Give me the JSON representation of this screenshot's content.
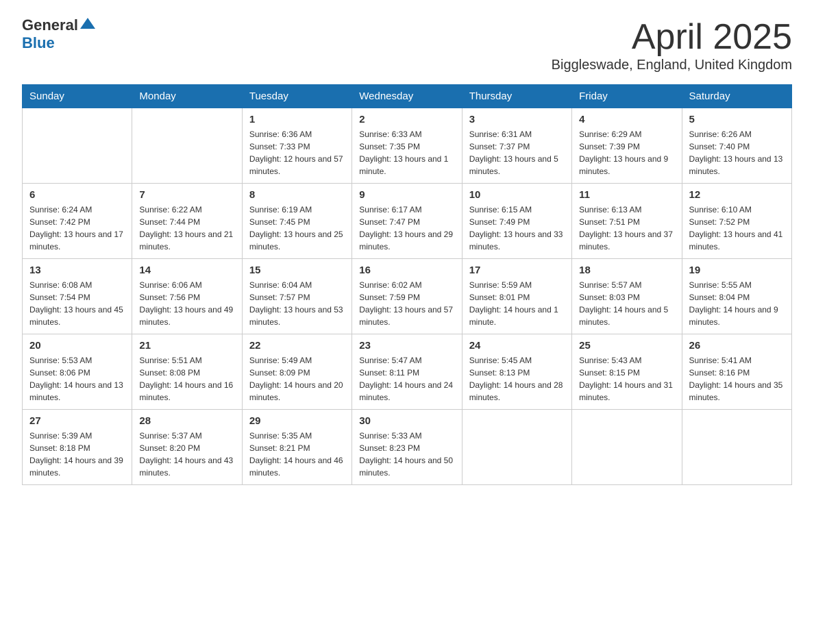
{
  "header": {
    "title": "April 2025",
    "location": "Biggleswade, England, United Kingdom",
    "logo_general": "General",
    "logo_blue": "Blue"
  },
  "days_of_week": [
    "Sunday",
    "Monday",
    "Tuesday",
    "Wednesday",
    "Thursday",
    "Friday",
    "Saturday"
  ],
  "weeks": [
    [
      {
        "day": "",
        "sunrise": "",
        "sunset": "",
        "daylight": ""
      },
      {
        "day": "",
        "sunrise": "",
        "sunset": "",
        "daylight": ""
      },
      {
        "day": "1",
        "sunrise": "Sunrise: 6:36 AM",
        "sunset": "Sunset: 7:33 PM",
        "daylight": "Daylight: 12 hours and 57 minutes."
      },
      {
        "day": "2",
        "sunrise": "Sunrise: 6:33 AM",
        "sunset": "Sunset: 7:35 PM",
        "daylight": "Daylight: 13 hours and 1 minute."
      },
      {
        "day": "3",
        "sunrise": "Sunrise: 6:31 AM",
        "sunset": "Sunset: 7:37 PM",
        "daylight": "Daylight: 13 hours and 5 minutes."
      },
      {
        "day": "4",
        "sunrise": "Sunrise: 6:29 AM",
        "sunset": "Sunset: 7:39 PM",
        "daylight": "Daylight: 13 hours and 9 minutes."
      },
      {
        "day": "5",
        "sunrise": "Sunrise: 6:26 AM",
        "sunset": "Sunset: 7:40 PM",
        "daylight": "Daylight: 13 hours and 13 minutes."
      }
    ],
    [
      {
        "day": "6",
        "sunrise": "Sunrise: 6:24 AM",
        "sunset": "Sunset: 7:42 PM",
        "daylight": "Daylight: 13 hours and 17 minutes."
      },
      {
        "day": "7",
        "sunrise": "Sunrise: 6:22 AM",
        "sunset": "Sunset: 7:44 PM",
        "daylight": "Daylight: 13 hours and 21 minutes."
      },
      {
        "day": "8",
        "sunrise": "Sunrise: 6:19 AM",
        "sunset": "Sunset: 7:45 PM",
        "daylight": "Daylight: 13 hours and 25 minutes."
      },
      {
        "day": "9",
        "sunrise": "Sunrise: 6:17 AM",
        "sunset": "Sunset: 7:47 PM",
        "daylight": "Daylight: 13 hours and 29 minutes."
      },
      {
        "day": "10",
        "sunrise": "Sunrise: 6:15 AM",
        "sunset": "Sunset: 7:49 PM",
        "daylight": "Daylight: 13 hours and 33 minutes."
      },
      {
        "day": "11",
        "sunrise": "Sunrise: 6:13 AM",
        "sunset": "Sunset: 7:51 PM",
        "daylight": "Daylight: 13 hours and 37 minutes."
      },
      {
        "day": "12",
        "sunrise": "Sunrise: 6:10 AM",
        "sunset": "Sunset: 7:52 PM",
        "daylight": "Daylight: 13 hours and 41 minutes."
      }
    ],
    [
      {
        "day": "13",
        "sunrise": "Sunrise: 6:08 AM",
        "sunset": "Sunset: 7:54 PM",
        "daylight": "Daylight: 13 hours and 45 minutes."
      },
      {
        "day": "14",
        "sunrise": "Sunrise: 6:06 AM",
        "sunset": "Sunset: 7:56 PM",
        "daylight": "Daylight: 13 hours and 49 minutes."
      },
      {
        "day": "15",
        "sunrise": "Sunrise: 6:04 AM",
        "sunset": "Sunset: 7:57 PM",
        "daylight": "Daylight: 13 hours and 53 minutes."
      },
      {
        "day": "16",
        "sunrise": "Sunrise: 6:02 AM",
        "sunset": "Sunset: 7:59 PM",
        "daylight": "Daylight: 13 hours and 57 minutes."
      },
      {
        "day": "17",
        "sunrise": "Sunrise: 5:59 AM",
        "sunset": "Sunset: 8:01 PM",
        "daylight": "Daylight: 14 hours and 1 minute."
      },
      {
        "day": "18",
        "sunrise": "Sunrise: 5:57 AM",
        "sunset": "Sunset: 8:03 PM",
        "daylight": "Daylight: 14 hours and 5 minutes."
      },
      {
        "day": "19",
        "sunrise": "Sunrise: 5:55 AM",
        "sunset": "Sunset: 8:04 PM",
        "daylight": "Daylight: 14 hours and 9 minutes."
      }
    ],
    [
      {
        "day": "20",
        "sunrise": "Sunrise: 5:53 AM",
        "sunset": "Sunset: 8:06 PM",
        "daylight": "Daylight: 14 hours and 13 minutes."
      },
      {
        "day": "21",
        "sunrise": "Sunrise: 5:51 AM",
        "sunset": "Sunset: 8:08 PM",
        "daylight": "Daylight: 14 hours and 16 minutes."
      },
      {
        "day": "22",
        "sunrise": "Sunrise: 5:49 AM",
        "sunset": "Sunset: 8:09 PM",
        "daylight": "Daylight: 14 hours and 20 minutes."
      },
      {
        "day": "23",
        "sunrise": "Sunrise: 5:47 AM",
        "sunset": "Sunset: 8:11 PM",
        "daylight": "Daylight: 14 hours and 24 minutes."
      },
      {
        "day": "24",
        "sunrise": "Sunrise: 5:45 AM",
        "sunset": "Sunset: 8:13 PM",
        "daylight": "Daylight: 14 hours and 28 minutes."
      },
      {
        "day": "25",
        "sunrise": "Sunrise: 5:43 AM",
        "sunset": "Sunset: 8:15 PM",
        "daylight": "Daylight: 14 hours and 31 minutes."
      },
      {
        "day": "26",
        "sunrise": "Sunrise: 5:41 AM",
        "sunset": "Sunset: 8:16 PM",
        "daylight": "Daylight: 14 hours and 35 minutes."
      }
    ],
    [
      {
        "day": "27",
        "sunrise": "Sunrise: 5:39 AM",
        "sunset": "Sunset: 8:18 PM",
        "daylight": "Daylight: 14 hours and 39 minutes."
      },
      {
        "day": "28",
        "sunrise": "Sunrise: 5:37 AM",
        "sunset": "Sunset: 8:20 PM",
        "daylight": "Daylight: 14 hours and 43 minutes."
      },
      {
        "day": "29",
        "sunrise": "Sunrise: 5:35 AM",
        "sunset": "Sunset: 8:21 PM",
        "daylight": "Daylight: 14 hours and 46 minutes."
      },
      {
        "day": "30",
        "sunrise": "Sunrise: 5:33 AM",
        "sunset": "Sunset: 8:23 PM",
        "daylight": "Daylight: 14 hours and 50 minutes."
      },
      {
        "day": "",
        "sunrise": "",
        "sunset": "",
        "daylight": ""
      },
      {
        "day": "",
        "sunrise": "",
        "sunset": "",
        "daylight": ""
      },
      {
        "day": "",
        "sunrise": "",
        "sunset": "",
        "daylight": ""
      }
    ]
  ]
}
